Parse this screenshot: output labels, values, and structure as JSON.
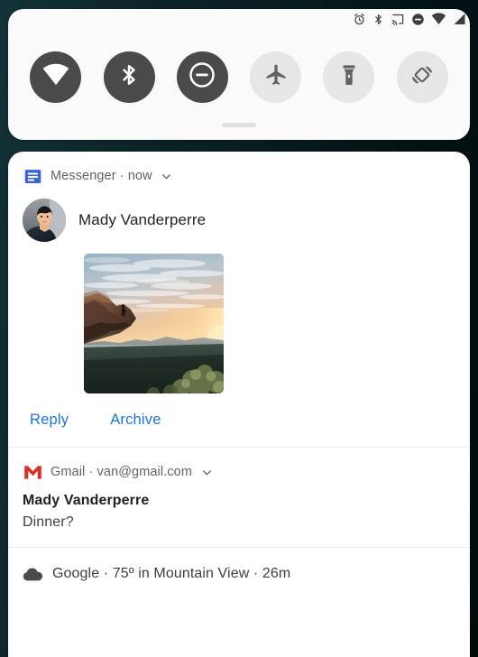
{
  "status_bar": {
    "icons": [
      {
        "name": "alarm-icon",
        "label": "alarm"
      },
      {
        "name": "bluetooth-icon",
        "label": "bluetooth"
      },
      {
        "name": "cast-icon",
        "label": "cast"
      },
      {
        "name": "do-not-disturb-icon",
        "label": "do not disturb"
      },
      {
        "name": "wifi-icon",
        "label": "wifi"
      },
      {
        "name": "cell-signal-icon",
        "label": "signal"
      }
    ]
  },
  "quick_settings": {
    "tiles": [
      {
        "name": "wifi-tile",
        "label": "Wi-Fi",
        "state": "on"
      },
      {
        "name": "bluetooth-tile",
        "label": "Bluetooth",
        "state": "on"
      },
      {
        "name": "do-not-disturb-tile",
        "label": "Do Not Disturb",
        "state": "on"
      },
      {
        "name": "airplane-mode-tile",
        "label": "Airplane mode",
        "state": "off"
      },
      {
        "name": "flashlight-tile",
        "label": "Flashlight",
        "state": "off"
      },
      {
        "name": "auto-rotate-tile",
        "label": "Auto-rotate",
        "state": "off"
      }
    ],
    "handle_label": "drag handle"
  },
  "notifications": [
    {
      "id": "messenger",
      "app_name": "Messenger",
      "header": "Messenger · now",
      "sender": "Mady Vanderperre",
      "has_image": true,
      "image_alt": "Sunset over cliff and valley",
      "actions": [
        {
          "name": "reply-action",
          "label": "Reply"
        },
        {
          "name": "archive-action",
          "label": "Archive"
        }
      ]
    },
    {
      "id": "gmail",
      "app_name": "Gmail",
      "header": "Gmail · van@gmail.com",
      "title": "Mady Vanderperre",
      "subject": "Dinner?"
    },
    {
      "id": "google",
      "app_name": "Google",
      "header": "Google · 75º in Mountain View · 26m"
    }
  ],
  "colors": {
    "accent_blue": "#1a73e8",
    "tile_on": "#4a4a4a",
    "tile_off": "#e6e6e6",
    "gmail_red": "#d93025",
    "messenger_blue": "#3b63d8",
    "card_bg": "#ffffff",
    "qs_bg": "#fafafa"
  }
}
